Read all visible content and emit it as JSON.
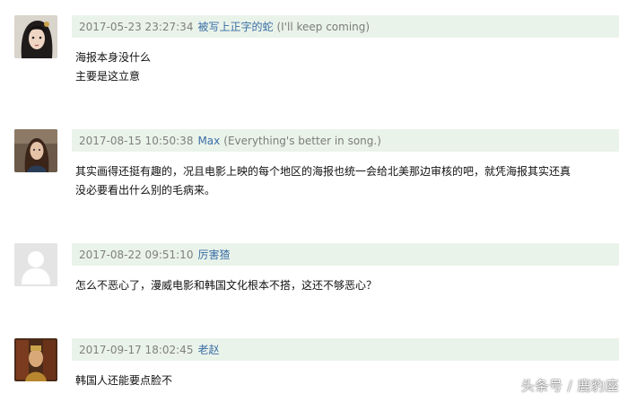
{
  "comments": [
    {
      "time": "2017-05-23 23:27:34",
      "author": "被写上正字的蛇",
      "motto": "(I'll keep coming)",
      "lines": [
        "海报本身没什么",
        "主要是这立意"
      ]
    },
    {
      "time": "2017-08-15 10:50:38",
      "author": "Max",
      "motto": "(Everything's better in song.)",
      "lines": [
        "其实画得还挺有趣的，况且电影上映的每个地区的海报也统一会给北美那边审核的吧，就凭海报其实还真",
        "没必要看出什么别的毛病来。"
      ]
    },
    {
      "time": "2017-08-22 09:51:10",
      "author": "厉害猹",
      "motto": "",
      "lines": [
        "怎么不恶心了，漫威电影和韩国文化根本不搭，这还不够恶心？"
      ]
    },
    {
      "time": "2017-09-17 18:02:45",
      "author": "老赵",
      "motto": "",
      "lines": [
        "韩国人还能要点脸不"
      ]
    }
  ],
  "watermark": "头条号 / 鹿豹座",
  "colors": {
    "header_bg": "#eaf3ea",
    "author_link": "#3a6ea5",
    "time": "#808080"
  }
}
